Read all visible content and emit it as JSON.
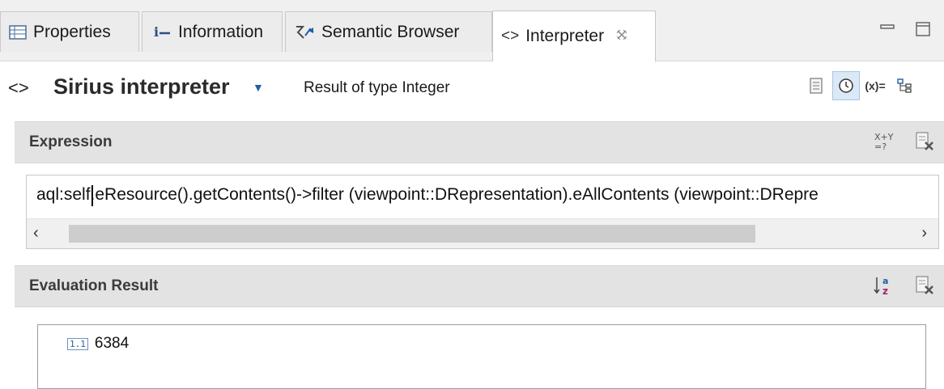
{
  "tabs": [
    {
      "label": "Properties",
      "icon": "properties-icon"
    },
    {
      "label": "Information",
      "icon": "information-icon"
    },
    {
      "label": "Semantic Browser",
      "icon": "semantic-browser-icon"
    },
    {
      "label": "Interpreter",
      "icon": "interpreter-icon",
      "active": true
    }
  ],
  "header": {
    "title": "Sirius interpreter",
    "result_type": "Result of type Integer",
    "variables_label": "(x)="
  },
  "expression": {
    "section_title": "Expression",
    "text": "aql:self.eResource().getContents()->filter (viewpoint::DRepresentation).eAllContents (viewpoint::DRepre"
  },
  "evaluation": {
    "section_title": "Evaluation Result",
    "value": "6384",
    "value_type_icon": "integer-icon"
  },
  "colors": {
    "accent": "#1f5ea8",
    "section_bg": "#e3e3e3",
    "pressed_bg": "#dbe8f5"
  }
}
